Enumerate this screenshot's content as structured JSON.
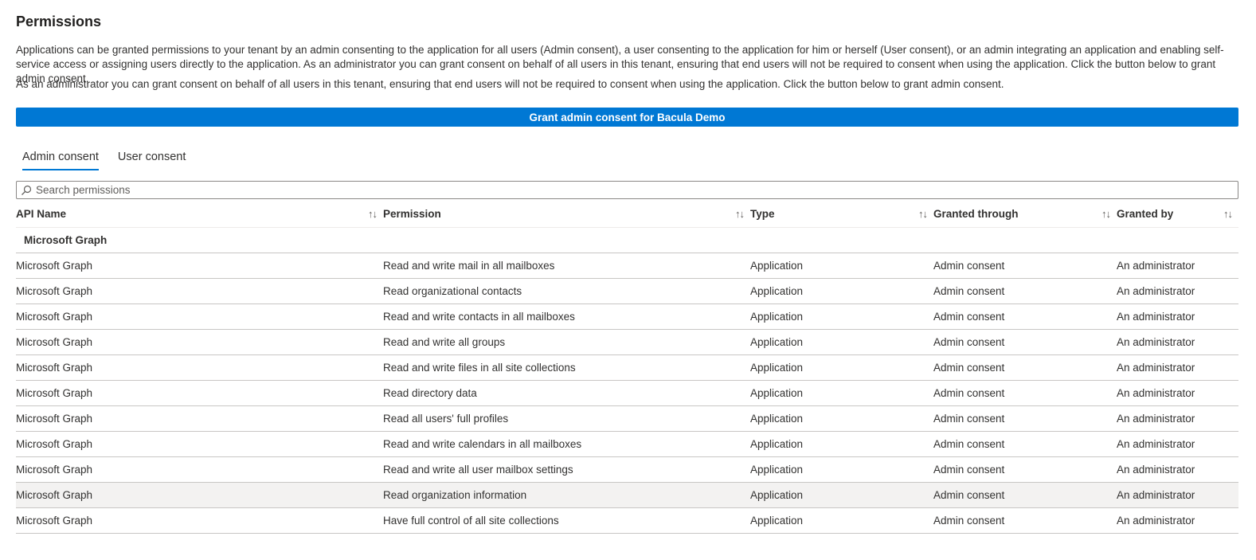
{
  "title": "Permissions",
  "description1": "Applications can be granted permissions to your tenant by an admin consenting to the application for all users (Admin consent), a user consenting to the application for him or herself (User consent), or an admin integrating an application and enabling self-service access or assigning users directly to the application. As an administrator you can grant consent on behalf of all users in this tenant, ensuring that end users will not be required to consent when using the application. Click the button below to grant admin consent.",
  "description2": "As an administrator you can grant consent on behalf of all users in this tenant, ensuring that end users will not be required to consent when using the application. Click the button below to grant admin consent.",
  "grant_button_label": "Grant admin consent for Bacula Demo",
  "tabs": [
    {
      "label": "Admin consent",
      "active": true
    },
    {
      "label": "User consent",
      "active": false
    }
  ],
  "search": {
    "placeholder": "Search permissions"
  },
  "columns": [
    "API Name",
    "Permission",
    "Type",
    "Granted through",
    "Granted by"
  ],
  "sort_glyph": "↑↓",
  "group_label": "Microsoft Graph",
  "rows": [
    {
      "api": "Microsoft Graph",
      "permission": "Read and write mail in all mailboxes",
      "type": "Application",
      "through": "Admin consent",
      "by": "An administrator"
    },
    {
      "api": "Microsoft Graph",
      "permission": "Read organizational contacts",
      "type": "Application",
      "through": "Admin consent",
      "by": "An administrator"
    },
    {
      "api": "Microsoft Graph",
      "permission": "Read and write contacts in all mailboxes",
      "type": "Application",
      "through": "Admin consent",
      "by": "An administrator"
    },
    {
      "api": "Microsoft Graph",
      "permission": "Read and write all groups",
      "type": "Application",
      "through": "Admin consent",
      "by": "An administrator"
    },
    {
      "api": "Microsoft Graph",
      "permission": "Read and write files in all site collections",
      "type": "Application",
      "through": "Admin consent",
      "by": "An administrator"
    },
    {
      "api": "Microsoft Graph",
      "permission": "Read directory data",
      "type": "Application",
      "through": "Admin consent",
      "by": "An administrator"
    },
    {
      "api": "Microsoft Graph",
      "permission": "Read all users' full profiles",
      "type": "Application",
      "through": "Admin consent",
      "by": "An administrator"
    },
    {
      "api": "Microsoft Graph",
      "permission": "Read and write calendars in all mailboxes",
      "type": "Application",
      "through": "Admin consent",
      "by": "An administrator"
    },
    {
      "api": "Microsoft Graph",
      "permission": "Read and write all user mailbox settings",
      "type": "Application",
      "through": "Admin consent",
      "by": "An administrator"
    },
    {
      "api": "Microsoft Graph",
      "permission": "Read organization information",
      "type": "Application",
      "through": "Admin consent",
      "by": "An administrator",
      "highlighted": true
    },
    {
      "api": "Microsoft Graph",
      "permission": "Have full control of all site collections",
      "type": "Application",
      "through": "Admin consent",
      "by": "An administrator"
    }
  ],
  "colors": {
    "accent": "#0078d4",
    "hover_row": "#f3f2f1"
  },
  "icons": {
    "search": "search-icon"
  }
}
